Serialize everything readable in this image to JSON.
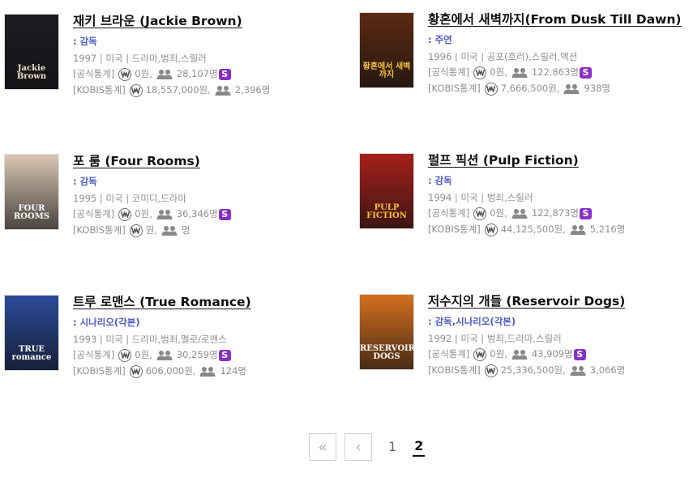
{
  "movies": [
    {
      "title": "재키 브라운 (Jackie Brown)",
      "role": ": 감독",
      "meta": "1997 | 미국 | 드라마,범죄,스릴러",
      "official_label": "[공식통계]",
      "official_revenue": "0원,",
      "official_audience": "28,107명",
      "kobis_label": "[KOBIS통계]",
      "kobis_revenue": "18,557,000원,",
      "kobis_audience": "2,396명",
      "s_badge": "S",
      "poster_text": "Jackie Brown",
      "poster_bg": "#1b1b22",
      "poster_fg": "#e9e1c8"
    },
    {
      "title": "황혼에서 새벽까지(From Dusk Till Dawn)",
      "role": ": 주연",
      "meta": "1996 | 미국 | 공포(호러),스릴러,액션",
      "official_label": "[공식통계]",
      "official_revenue": "0원,",
      "official_audience": "122,863명",
      "kobis_label": "[KOBIS통계]",
      "kobis_revenue": "7,666,500원,",
      "kobis_audience": "938명",
      "s_badge": "S",
      "poster_text": "황혼에서 새벽까지",
      "poster_bg": "#5c2a12",
      "poster_fg": "#f3c33d"
    },
    {
      "title": "포 룸 (Four Rooms)",
      "role": ": 감독",
      "meta": "1995 | 미국 | 코미디,드라마",
      "official_label": "[공식통계]",
      "official_revenue": "0원,",
      "official_audience": "36,346명",
      "kobis_label": "[KOBIS통계]",
      "kobis_revenue": "원,",
      "kobis_audience": "명",
      "s_badge": "S",
      "poster_text": "FOUR ROOMS",
      "poster_bg": "#d9c7b3",
      "poster_fg": "#ffffff"
    },
    {
      "title": "펄프 픽션 (Pulp Fiction)",
      "role": ": 감독",
      "meta": "1994 | 미국 | 범죄,스릴러",
      "official_label": "[공식통계]",
      "official_revenue": "0원,",
      "official_audience": "122,873명",
      "kobis_label": "[KOBIS통계]",
      "kobis_revenue": "44,125,500원,",
      "kobis_audience": "5,216명",
      "s_badge": "S",
      "poster_text": "PULP FICTION",
      "poster_bg": "#a8201a",
      "poster_fg": "#f2c230"
    },
    {
      "title": "트루 로맨스 (True Romance)",
      "role": ": 시나리오(각본)",
      "meta": "1993 | 미국 | 드라마,범죄,멜로/로맨스",
      "official_label": "[공식통계]",
      "official_revenue": "0원,",
      "official_audience": "30,259명",
      "kobis_label": "[KOBIS통계]",
      "kobis_revenue": "606,000원,",
      "kobis_audience": "124명",
      "s_badge": "S",
      "poster_text": "TRUE romance",
      "poster_bg": "#2a4a9a",
      "poster_fg": "#ffffff"
    },
    {
      "title": "저수지의 개들 (Reservoir Dogs)",
      "role": ": 감독,시나리오(각본)",
      "meta": "1992 | 미국 | 범죄,드라마,스릴러",
      "official_label": "[공식통계]",
      "official_revenue": "0원,",
      "official_audience": "43,909명",
      "kobis_label": "[KOBIS통계]",
      "kobis_revenue": "25,336,500원,",
      "kobis_audience": "3,066명",
      "s_badge": "S",
      "poster_text": "RESERVOIR DOGS",
      "poster_bg": "#d46f1f",
      "poster_fg": "#ffffff"
    }
  ],
  "pagination": {
    "first_label": "«",
    "prev_label": "‹",
    "pages": [
      "1",
      "2"
    ],
    "current": "2"
  },
  "colors": {
    "role_accent": "#4b5bc4",
    "s_badge": "#8a2fc6",
    "meta_text": "#8f8f8f"
  },
  "icons": {
    "revenue": "won-coin-icon",
    "audience": "people-icon",
    "badge": "s-badge-icon",
    "first": "double-chevron-left-icon",
    "prev": "chevron-left-icon"
  }
}
